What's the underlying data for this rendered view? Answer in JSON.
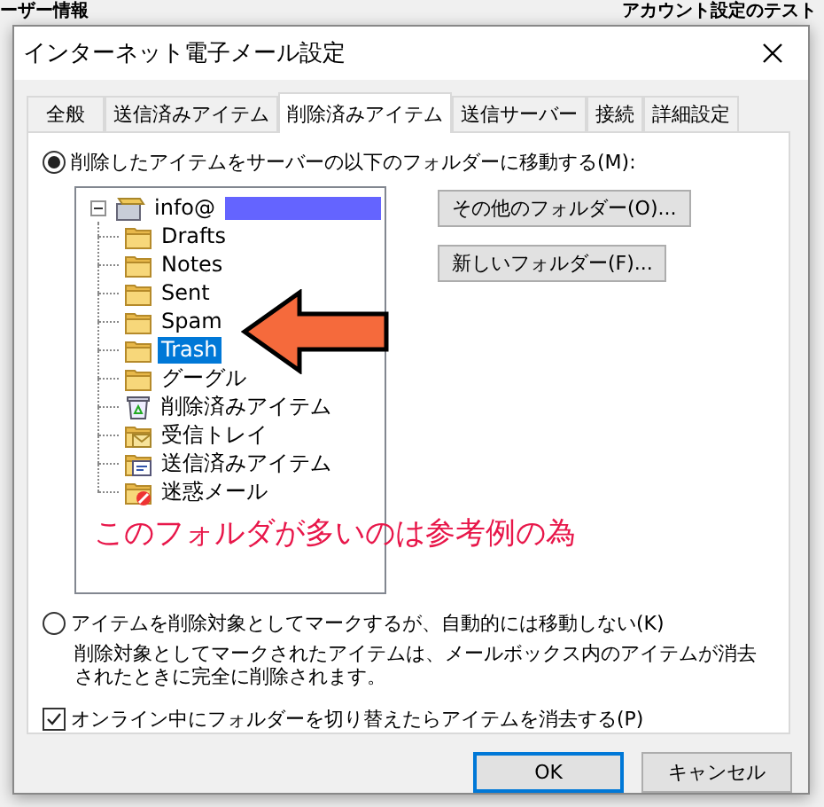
{
  "background": {
    "left_heading": "ーザー情報",
    "right_heading": "アカウント設定のテスト"
  },
  "window": {
    "title": "インターネット電子メール設定"
  },
  "tabs": [
    {
      "label": "全般",
      "selected": false
    },
    {
      "label": "送信済みアイテム",
      "selected": false
    },
    {
      "label": "削除済みアイテム",
      "selected": true
    },
    {
      "label": "送信サーバー",
      "selected": false
    },
    {
      "label": "接続",
      "selected": false
    },
    {
      "label": "詳細設定",
      "selected": false
    }
  ],
  "move_option": {
    "label": "削除したアイテムをサーバーの以下のフォルダーに移動する(M):",
    "selected": true
  },
  "folder_tree": {
    "root": {
      "label": "info@",
      "expanded": true,
      "children": [
        {
          "label": "Drafts",
          "kind": "folder",
          "selected": false
        },
        {
          "label": "Notes",
          "kind": "folder",
          "selected": false
        },
        {
          "label": "Sent",
          "kind": "folder",
          "selected": false
        },
        {
          "label": "Spam",
          "kind": "folder",
          "selected": false
        },
        {
          "label": "Trash",
          "kind": "folder",
          "selected": true
        },
        {
          "label": "グーグル",
          "kind": "folder",
          "selected": false
        },
        {
          "label": "削除済みアイテム",
          "kind": "trash",
          "selected": false
        },
        {
          "label": "受信トレイ",
          "kind": "inbox",
          "selected": false
        },
        {
          "label": "送信済みアイテム",
          "kind": "sent",
          "selected": false
        },
        {
          "label": "迷惑メール",
          "kind": "junk",
          "selected": false
        }
      ]
    }
  },
  "folder_buttons": [
    "その他のフォルダー(O)...",
    "新しいフォルダー(F)..."
  ],
  "annotation": "このフォルダが多いのは参考例の為",
  "mark_option": {
    "label": "アイテムを削除対象としてマークするが、自動的には移動しない(K)",
    "selected": false,
    "description": "削除対象としてマークされたアイテムは、メールボックス内のアイテムが消去されたときに完全に削除されます。"
  },
  "purge_checkbox": {
    "label": "オンライン中にフォルダーを切り替えたらアイテムを消去する(P)",
    "checked": true
  },
  "buttons": [
    {
      "label": "OK",
      "default": true
    },
    {
      "label": "キャンセル",
      "default": false
    }
  ]
}
